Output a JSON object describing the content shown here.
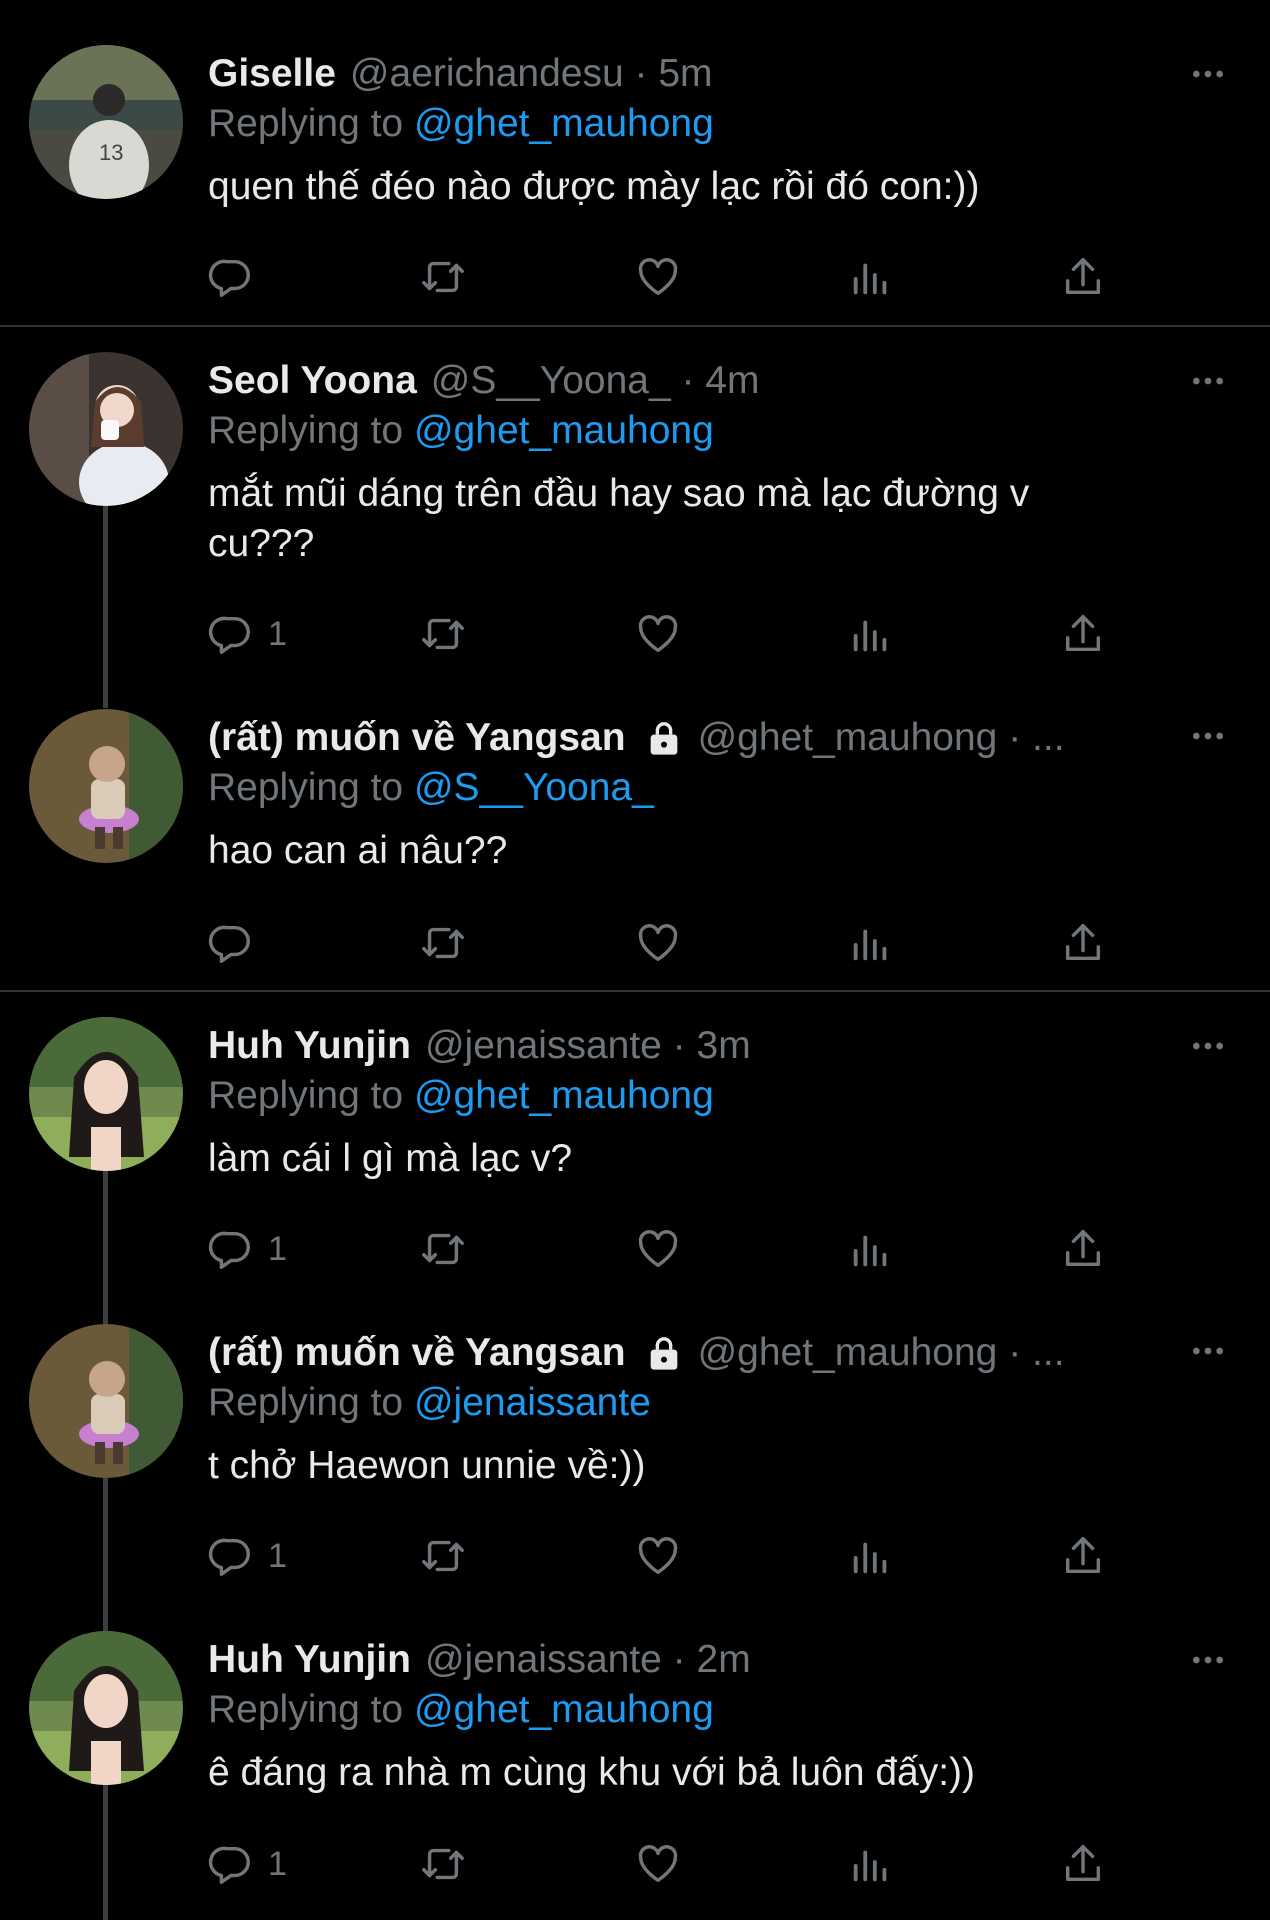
{
  "replying_prefix": "Replying to",
  "tweets": [
    {
      "name": "Giselle",
      "handle": "@aerichandesu · 5m",
      "replying_to": "@ghet_mauhong",
      "text": "quen thế đéo nào được mày lạc rồi đó con:))",
      "reply_count": "",
      "locked": false,
      "avatar_icon": "giselle-avatar"
    },
    {
      "name": "Seol Yoona",
      "handle": "@S__Yoona_ · 4m",
      "replying_to": "@ghet_mauhong",
      "text": "mắt mũi dáng trên đầu hay sao mà lạc đường v cu???",
      "reply_count": "1",
      "locked": false,
      "avatar_icon": "yoona-avatar"
    },
    {
      "name": "(rất) muốn về Yangsan",
      "handle": "@ghet_mauhong · ...",
      "replying_to": "@S__Yoona_",
      "text": "hao can ai nâu??",
      "reply_count": "",
      "locked": true,
      "avatar_icon": "game-character-avatar"
    },
    {
      "name": "Huh Yunjin",
      "handle": "@jenaissante · 3m",
      "replying_to": "@ghet_mauhong",
      "text": "làm cái l gì mà lạc v?",
      "reply_count": "1",
      "locked": false,
      "avatar_icon": "yunjin-avatar"
    },
    {
      "name": "(rất) muốn về Yangsan",
      "handle": "@ghet_mauhong · ...",
      "replying_to": "@jenaissante",
      "text": "t chở Haewon unnie về:))",
      "reply_count": "1",
      "locked": true,
      "avatar_icon": "game-character-avatar"
    },
    {
      "name": "Huh Yunjin",
      "handle": "@jenaissante · 2m",
      "replying_to": "@ghet_mauhong",
      "text": "ê đáng ra nhà m cùng khu với bả luôn đấy:))",
      "reply_count": "1",
      "locked": false,
      "avatar_icon": "yunjin-avatar"
    }
  ],
  "colors": {
    "background": "#000000",
    "text": "#e7e9ea",
    "secondary": "#71767b",
    "link": "#1d9bf0",
    "divider": "#2f3336"
  }
}
